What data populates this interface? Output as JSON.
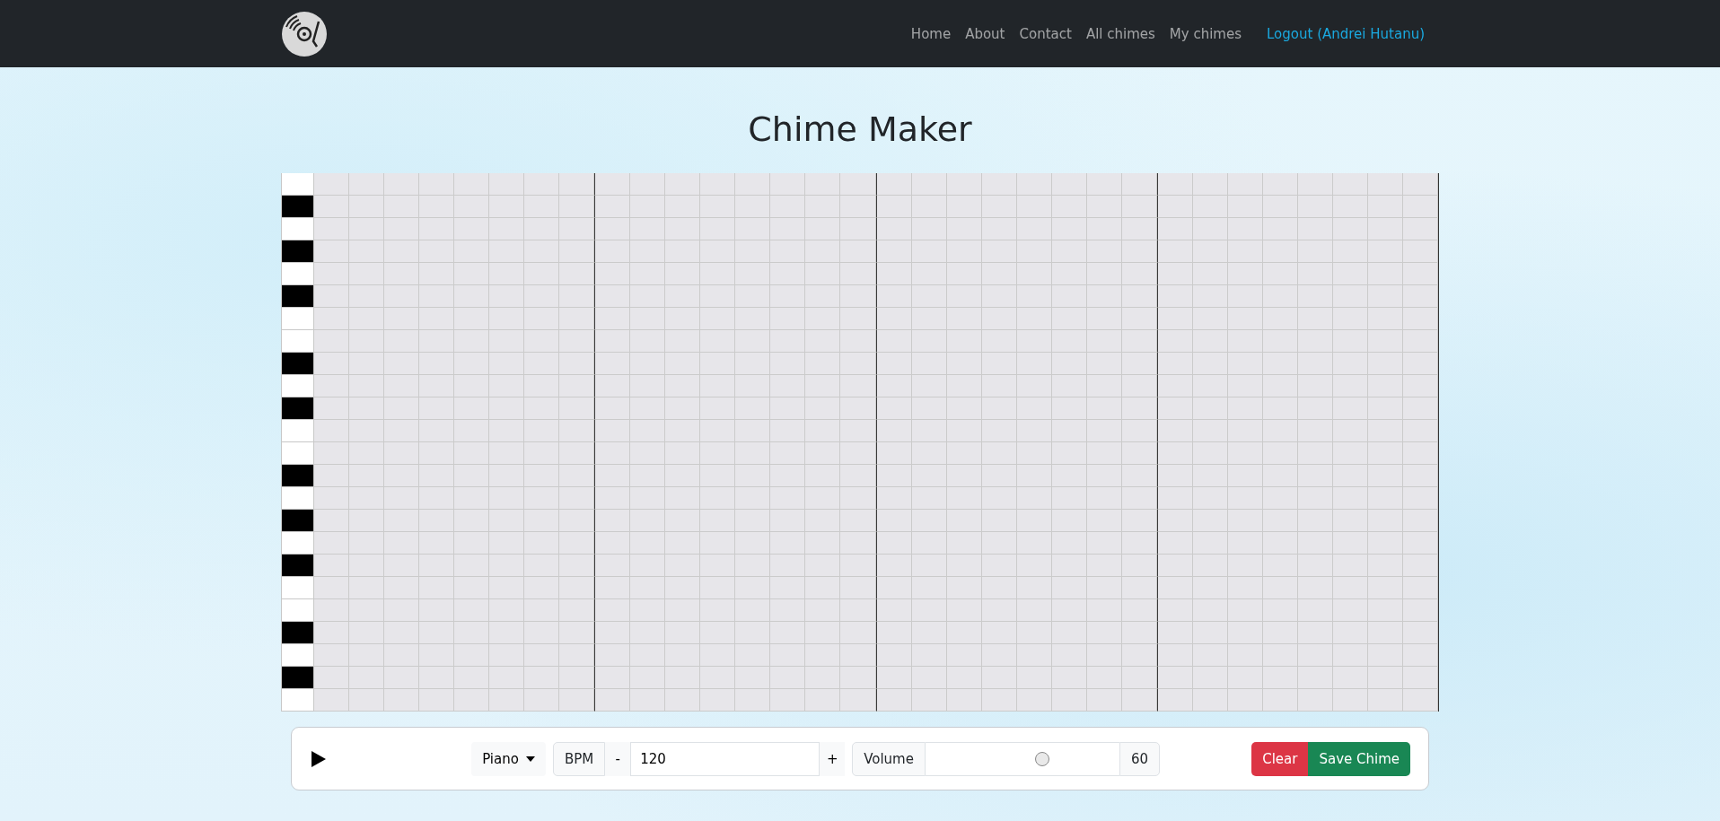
{
  "navbar": {
    "links": [
      {
        "label": "Home"
      },
      {
        "label": "About"
      },
      {
        "label": "Contact"
      },
      {
        "label": "All chimes"
      },
      {
        "label": "My chimes"
      }
    ],
    "logout": "Logout (Andrei Hutanu)"
  },
  "title": "Chime Maker",
  "piano_roll": {
    "keys": [
      {
        "kind": "white"
      },
      {
        "kind": "black"
      },
      {
        "kind": "white"
      },
      {
        "kind": "black"
      },
      {
        "kind": "white"
      },
      {
        "kind": "black"
      },
      {
        "kind": "white"
      },
      {
        "kind": "white"
      },
      {
        "kind": "black"
      },
      {
        "kind": "white"
      },
      {
        "kind": "black"
      },
      {
        "kind": "white"
      },
      {
        "kind": "white"
      },
      {
        "kind": "black"
      },
      {
        "kind": "white"
      },
      {
        "kind": "black"
      },
      {
        "kind": "white"
      },
      {
        "kind": "black"
      },
      {
        "kind": "white"
      },
      {
        "kind": "white"
      },
      {
        "kind": "black"
      },
      {
        "kind": "white"
      },
      {
        "kind": "black"
      },
      {
        "kind": "white"
      }
    ]
  },
  "controls": {
    "instrument": "Piano",
    "bpm": {
      "label": "BPM",
      "decrement": "-",
      "value": "120",
      "increment": "+"
    },
    "volume": {
      "label": "Volume",
      "level": 0.6,
      "reading": "60"
    },
    "buttons": [
      {
        "label": "Clear",
        "kind": "danger"
      },
      {
        "label": "Save Chime",
        "kind": "success"
      }
    ]
  }
}
